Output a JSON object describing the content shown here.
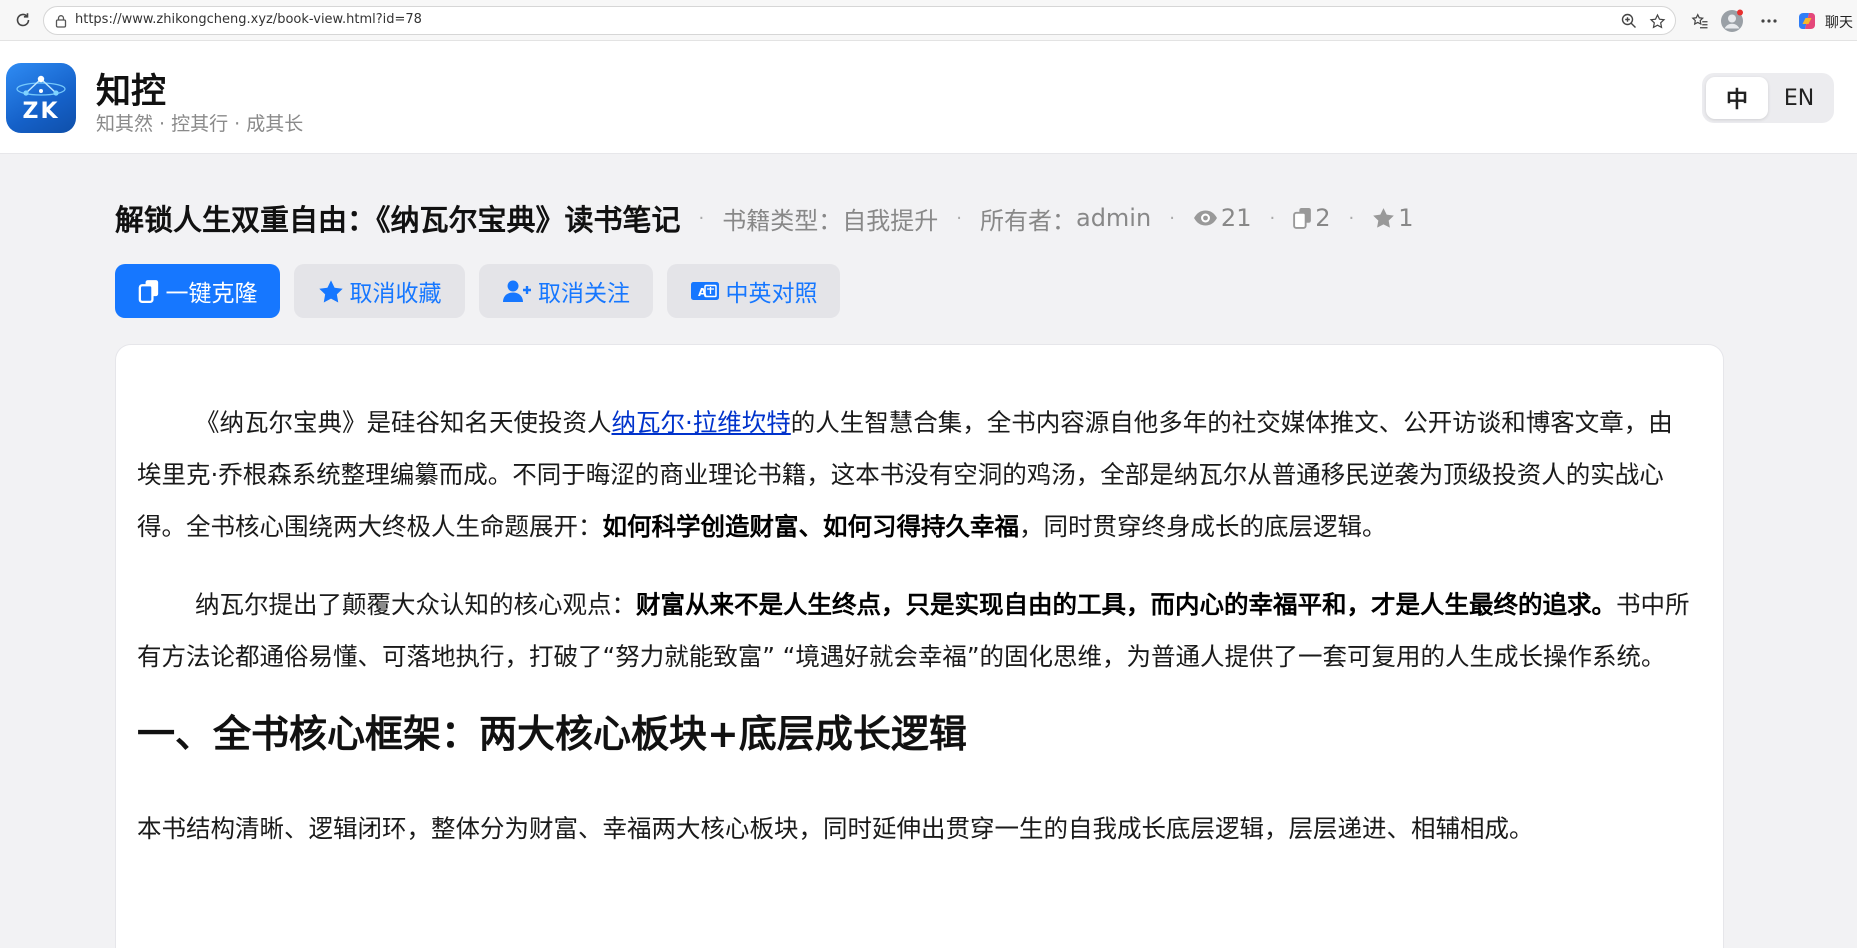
{
  "browser": {
    "url": "https://www.zhikongcheng.xyz/book-view.html?id=78",
    "chat_label": "聊天"
  },
  "header": {
    "logo_text": "ZK",
    "brand_name": "知控",
    "slogan": "知其然 · 控其行 · 成其长",
    "lang_options": [
      "中",
      "EN"
    ],
    "lang_active": "中"
  },
  "book": {
    "title": "解锁人生双重自由：《纳瓦尔宝典》读书笔记",
    "category_label": "书籍类型：",
    "category_value": "自我提升",
    "owner_label": "所有者：",
    "owner_value": "admin",
    "views": "21",
    "clones": "2",
    "favorites": "1"
  },
  "actions": {
    "clone_label": "一键克隆",
    "unfavorite_label": "取消收藏",
    "unfollow_label": "取消关注",
    "bilingual_label": "中英对照"
  },
  "article": {
    "p1": {
      "part1": "《纳瓦尔宝典》是硅谷知名天使投资人",
      "link": "纳瓦尔·拉维坎特",
      "part2": "的人生智慧合集，全书内容源自他多年的社交媒体推文、公开访谈和博客文章，由埃里克·乔根森系统整理编纂而成。不同于晦涩的商业理论书籍，这本书没有空洞的鸡汤，全部是纳瓦尔从普通移民逆袭为顶级投资人的实战心得。全书核心围绕两大终极人生命题展开：",
      "bold": "如何科学创造财富、如何习得持久幸福",
      "part3": "，同时贯穿终身成长的底层逻辑。"
    },
    "p2": {
      "part1": "纳瓦尔提出了颠覆大众认知的核心观点：",
      "bold": "财富从来不是人生终点，只是实现自由的工具，而内心的幸福平和，才是人生最终的追求。",
      "part2": "书中所有方法论都通俗易懂、可落地执行，打破了“努力就能致富” “境遇好就会幸福”的固化思维，为普通人提供了一套可复用的人生成长操作系统。"
    },
    "heading1": "一、全书核心框架：两大核心板块+底层成长逻辑",
    "p3": "本书结构清晰、逻辑闭环，整体分为财富、幸福两大核心板块，同时延伸出贯穿一生的自我成长底层逻辑，层层递进、相辅相成。"
  },
  "colors": {
    "accent": "#1677ff",
    "link": "#0033cc",
    "page_bg": "#f2f2f4",
    "muted_text": "#888888"
  }
}
